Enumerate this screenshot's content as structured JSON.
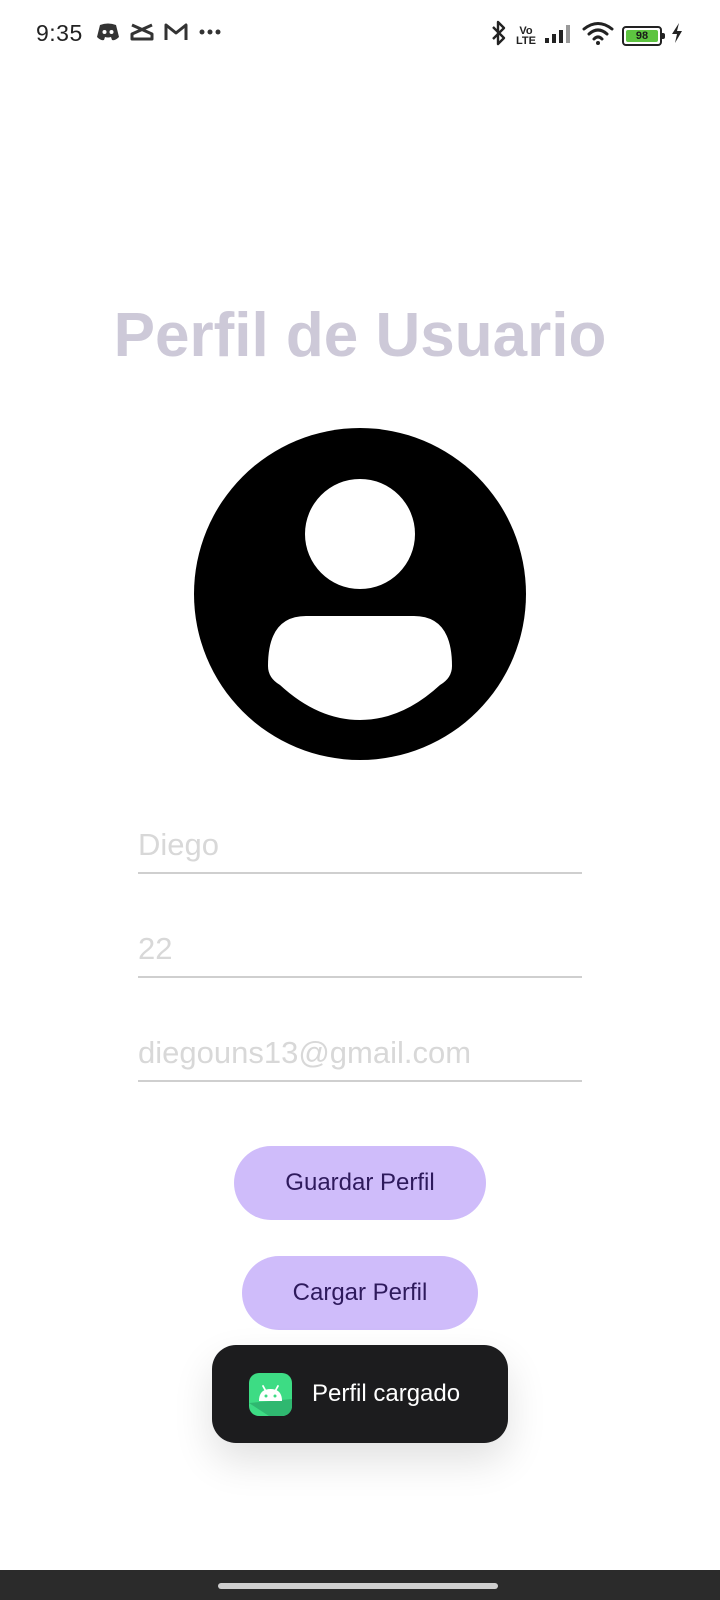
{
  "status_bar": {
    "time": "9:35",
    "left_icons": [
      "discord-icon",
      "capcut-icon",
      "gmail-icon",
      "more-dots-icon"
    ],
    "right_icons": [
      "bluetooth-icon",
      "volte-icon",
      "signal-icon",
      "wifi-icon",
      "battery-icon",
      "charging-icon"
    ],
    "lte_top": "Vo",
    "lte_bottom": "LTE",
    "battery_level": "98"
  },
  "profile": {
    "title": "Perfil de Usuario",
    "avatar_icon": "account-circle-icon",
    "fields": {
      "name_placeholder": "Diego",
      "age_placeholder": "22",
      "email_placeholder": "diegouns13@gmail.com"
    },
    "buttons": {
      "save_label": "Guardar Perfil",
      "load_label": "Cargar Perfil"
    }
  },
  "toast": {
    "icon": "android-app-icon",
    "message": "Perfil cargado"
  },
  "colors": {
    "title": "#cdc9d8",
    "button_bg": "#cfbcfa",
    "button_text": "#2e1a5c",
    "toast_bg": "#1c1c1e",
    "battery_fill": "#5dc440",
    "android_green": "#3ddc84"
  }
}
